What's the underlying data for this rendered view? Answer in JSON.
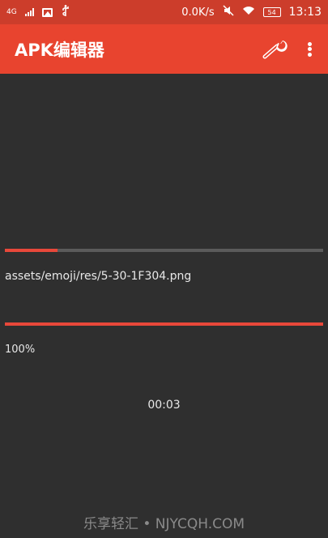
{
  "status_bar": {
    "network": "4G",
    "speed": "0.0K/s",
    "battery": "54",
    "time": "13:13"
  },
  "app_bar": {
    "title": "APK编辑器",
    "actions": [
      "wrench-icon",
      "more-vert-icon"
    ]
  },
  "task": {
    "current_file": "assets/emoji/res/5-30-1F304.png",
    "file_progress": 0.165,
    "overall_progress": 1.0,
    "percent_label": "100%",
    "elapsed": "00:03"
  },
  "watermark": "乐享轻汇 • NJYCQH.COM",
  "colors": {
    "status_bar": "#cc3d2b",
    "app_bar": "#e8442f",
    "background": "#2f2f2f",
    "progress": "#e8483a",
    "track": "#5b5b5b"
  }
}
